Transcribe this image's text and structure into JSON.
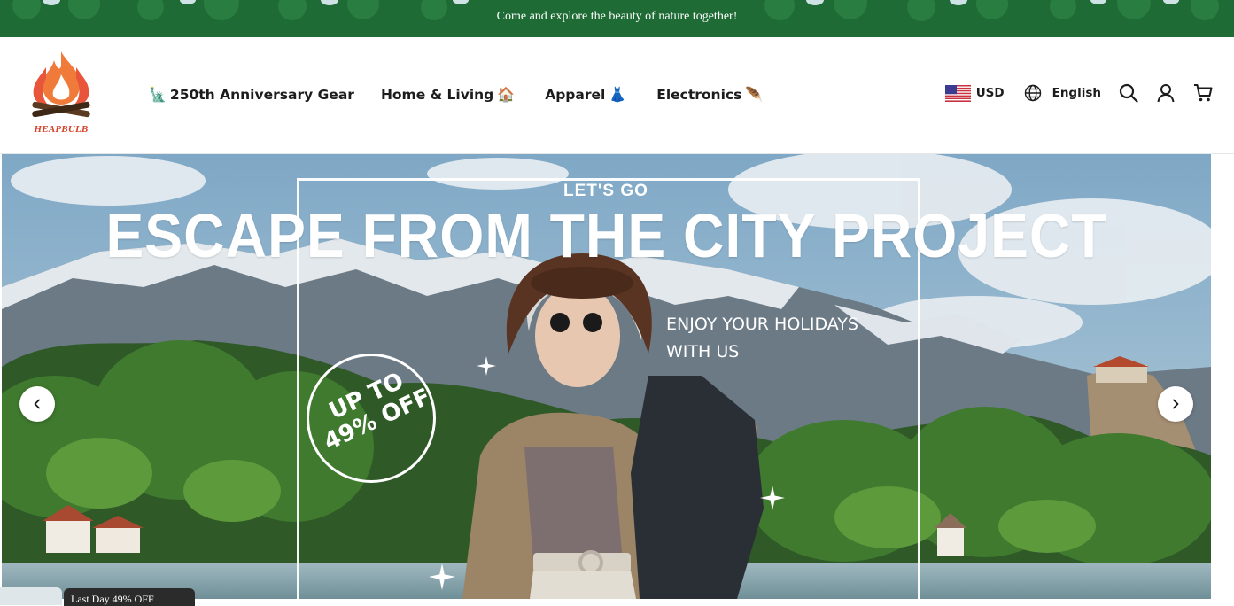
{
  "announcement": {
    "text": "Come and explore the beauty of nature together!"
  },
  "brand": {
    "name": "HEAPBULB"
  },
  "nav": {
    "items": [
      {
        "label": "250th Anniversary Gear",
        "emoji_before": "🗽",
        "emoji_after": ""
      },
      {
        "label": "Home & Living",
        "emoji_before": "",
        "emoji_after": "🏠"
      },
      {
        "label": "Apparel",
        "emoji_before": "",
        "emoji_after": "👗"
      },
      {
        "label": "Electronics",
        "emoji_before": "",
        "emoji_after": "🪶"
      }
    ]
  },
  "tools": {
    "currency": "USD",
    "language": "English",
    "icons": [
      "us-flag-icon",
      "globe-icon",
      "search-icon",
      "account-icon",
      "cart-icon"
    ]
  },
  "hero": {
    "kicker": "LET'S GO",
    "headline": "ESCAPE FROM THE CITY PROJECT",
    "sub_line1": "ENJOY YOUR HOLIDAYS",
    "sub_line2": "WITH US",
    "badge_line1": "UP TO",
    "badge_line2": "49% OFF",
    "prev_icon": "chevron-left-icon",
    "next_icon": "chevron-right-icon"
  },
  "popup": {
    "text": "Last Day 49% OFF"
  },
  "colors": {
    "announcement_bg": "#1e6b35",
    "brand_red": "#d8432a",
    "text_dark": "#1c1c1c"
  }
}
